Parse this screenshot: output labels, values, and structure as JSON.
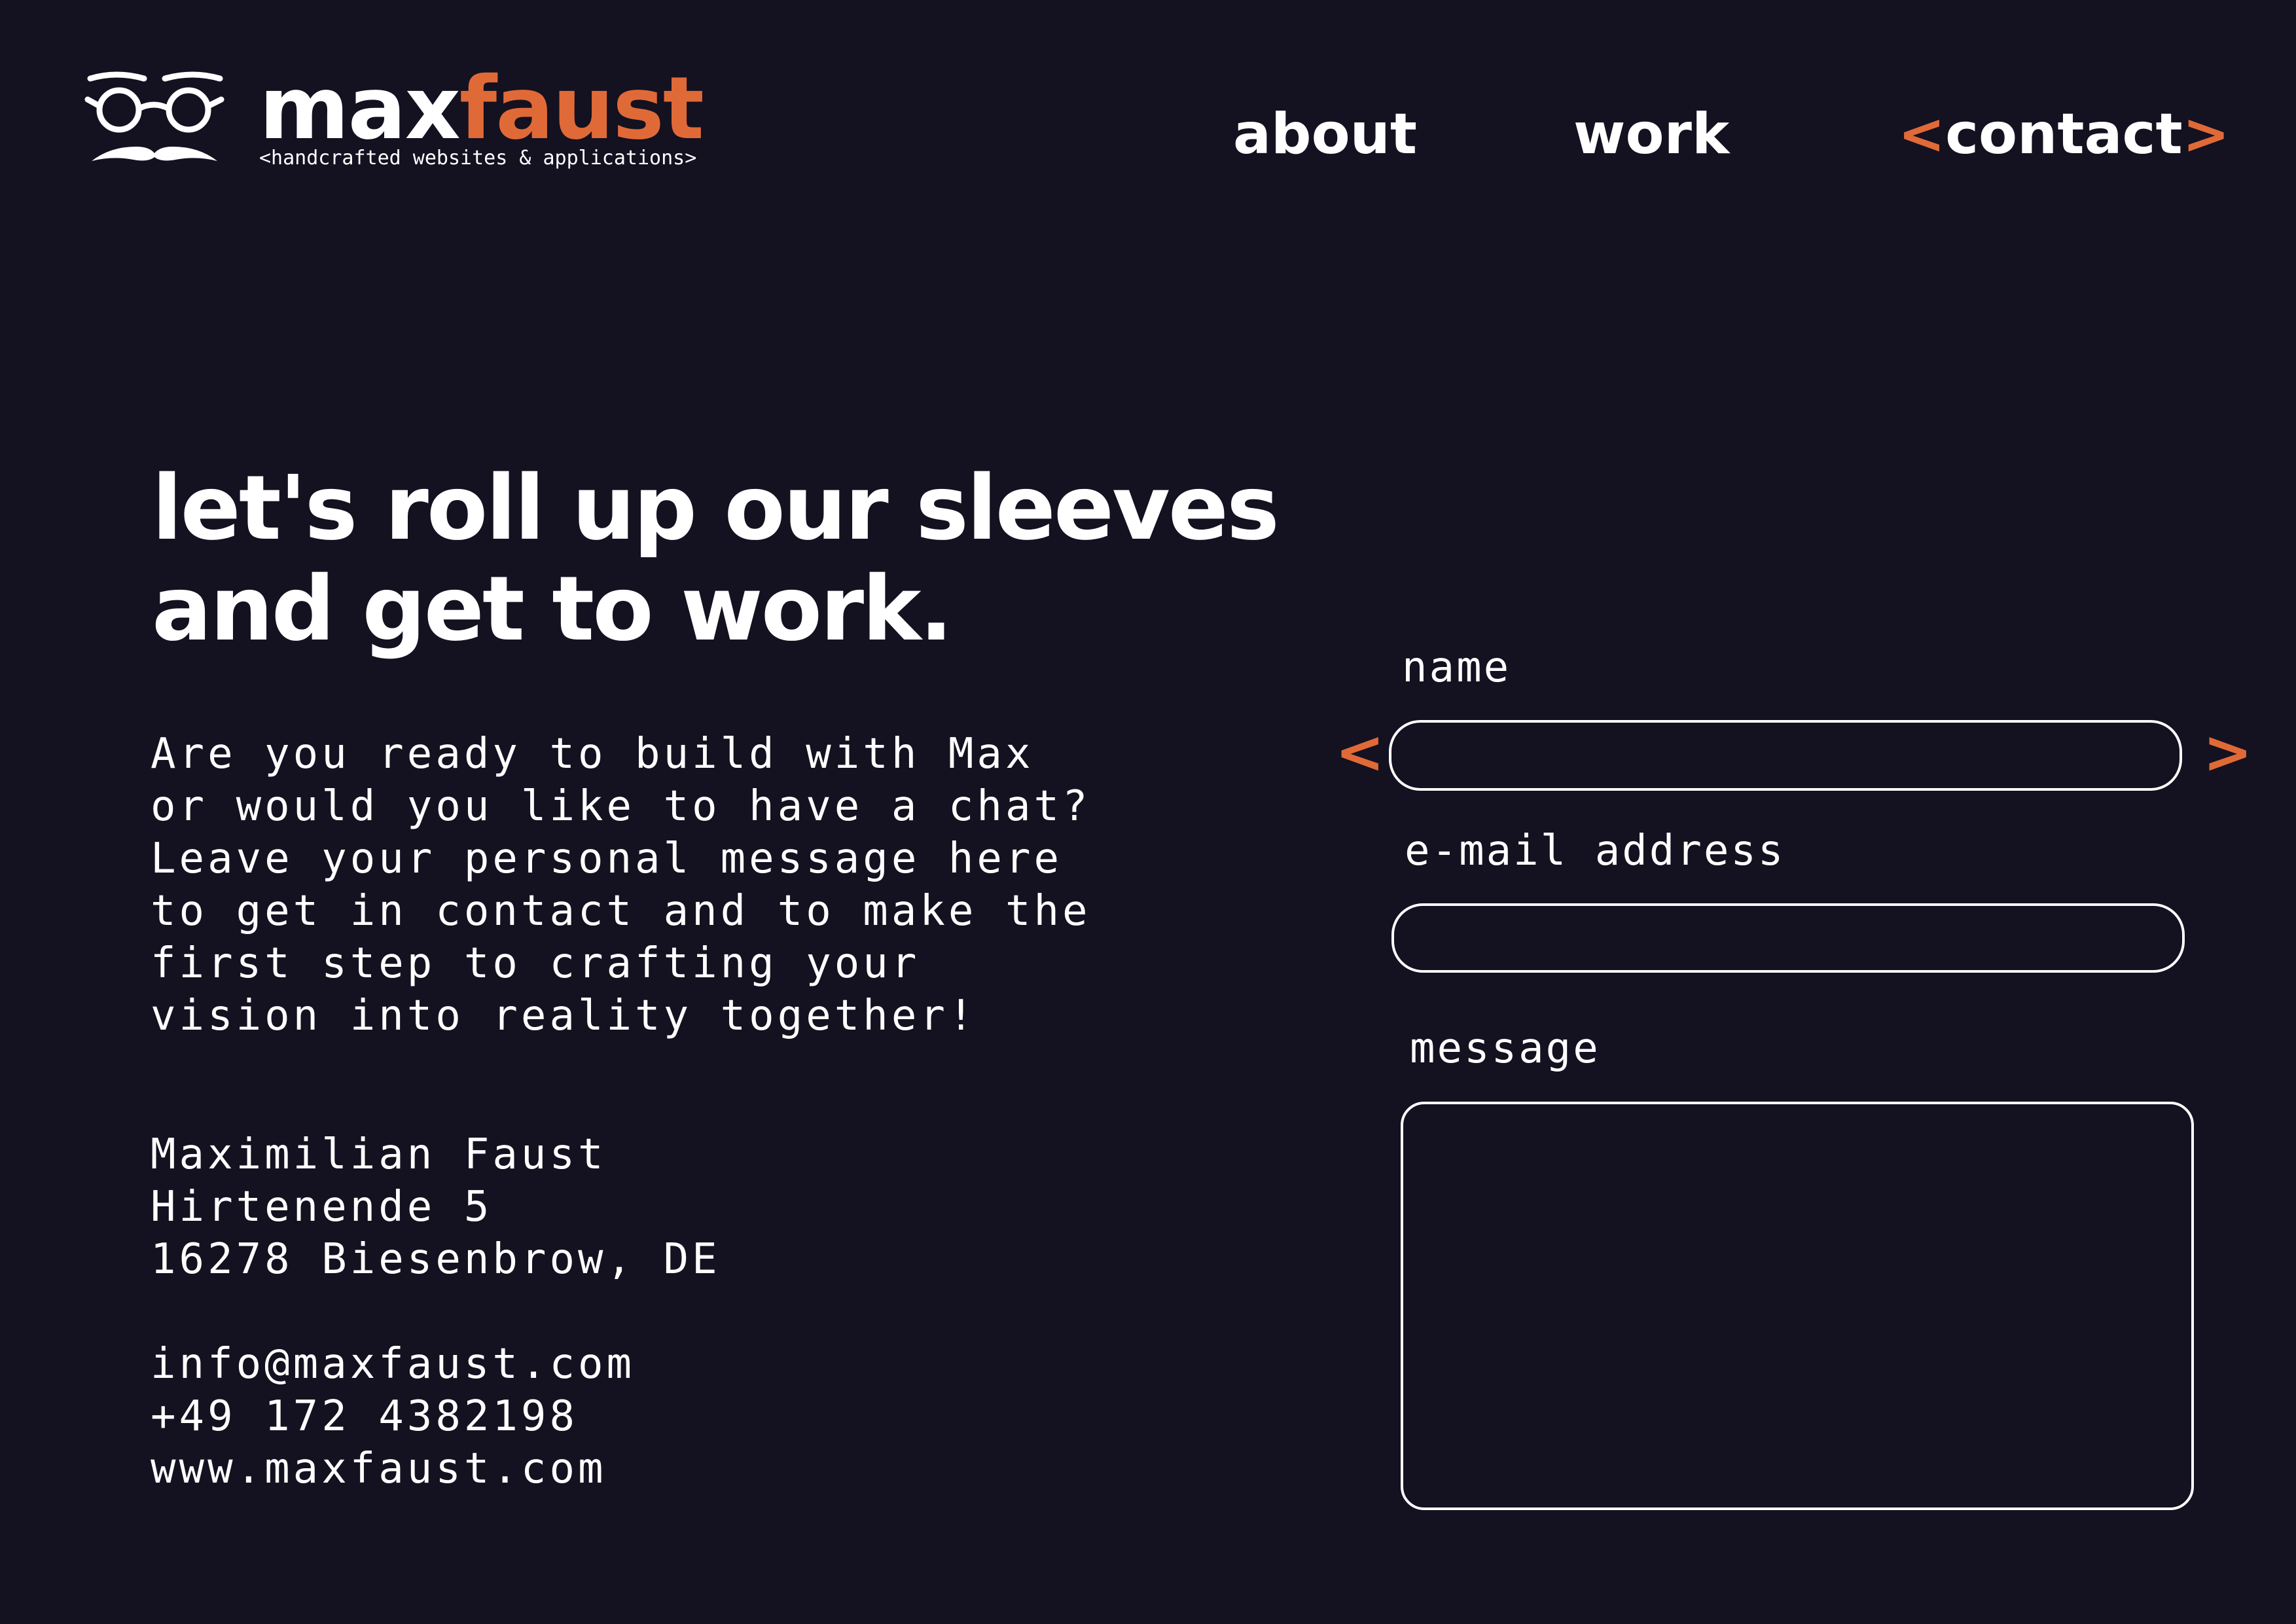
{
  "brand": {
    "name_part1": "max",
    "name_part2": "faust",
    "tagline": "<handcrafted websites & applications>",
    "logo_icon": "glasses-mustache-icon",
    "accent_color": "#e06a37",
    "background_color": "#141120"
  },
  "nav": {
    "about": "about",
    "work": "work",
    "contact_open": "<",
    "contact": "contact",
    "contact_close": ">"
  },
  "hero": {
    "title_line1": "let's roll up our sleeves",
    "title_line2": "and get to work."
  },
  "intro": {
    "lines": [
      "Are you ready to build with Max",
      "or would you like to have a chat?",
      "Leave your personal message here",
      "to get in contact and to make the",
      "first step to crafting your",
      "vision into reality together!"
    ]
  },
  "address": {
    "name": "Maximilian Faust",
    "street": "Hirtenende 5",
    "city": "16278 Biesenbrow, DE"
  },
  "contact": {
    "email": "info@maxfaust.com",
    "phone": "+49 172 4382198",
    "web": "www.maxfaust.com"
  },
  "form": {
    "name_label": "name",
    "name_value": "",
    "email_label": "e-mail address",
    "email_value": "",
    "message_label": "message",
    "message_value": "",
    "focus_indicator_left": "<",
    "focus_indicator_right": ">"
  }
}
